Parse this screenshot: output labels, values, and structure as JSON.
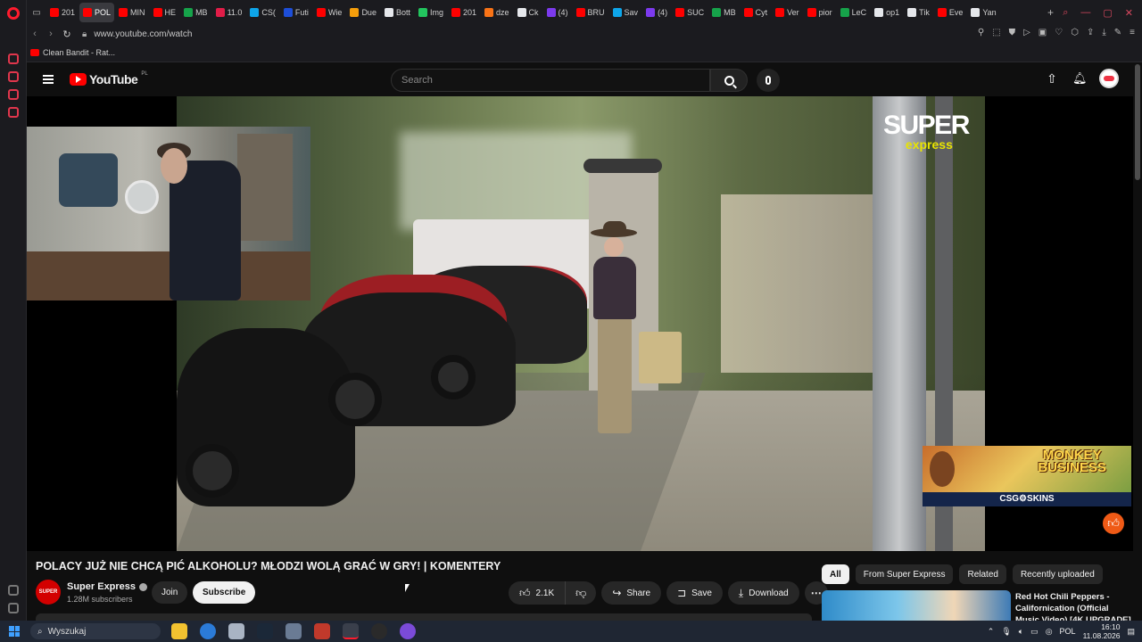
{
  "browser": {
    "tabs": [
      {
        "label": "201",
        "color": "#ff0000"
      },
      {
        "label": "POL",
        "color": "#ff0000",
        "active": true
      },
      {
        "label": "MIN",
        "color": "#ff0000"
      },
      {
        "label": "HE",
        "color": "#ff0000"
      },
      {
        "label": "MB",
        "color": "#16a34a"
      },
      {
        "label": "11.0",
        "color": "#e11d48"
      },
      {
        "label": "CS(",
        "color": "#0ea5e9"
      },
      {
        "label": "Futi",
        "color": "#1d4ed8"
      },
      {
        "label": "Wie",
        "color": "#ff0000"
      },
      {
        "label": "Due",
        "color": "#f59e0b"
      },
      {
        "label": "Bott",
        "color": "#e5e7eb"
      },
      {
        "label": "Img",
        "color": "#22c55e"
      },
      {
        "label": "201",
        "color": "#ff0000"
      },
      {
        "label": "dze",
        "color": "#f97316"
      },
      {
        "label": "Ck",
        "color": "#e5e7eb"
      },
      {
        "label": "(4)",
        "color": "#7c3aed"
      },
      {
        "label": "BRU",
        "color": "#ff0000"
      },
      {
        "label": "Sav",
        "color": "#0ea5e9"
      },
      {
        "label": "(4)",
        "color": "#7c3aed"
      },
      {
        "label": "SUC",
        "color": "#ff0000"
      },
      {
        "label": "MB",
        "color": "#16a34a"
      },
      {
        "label": "Cyt",
        "color": "#ff0000"
      },
      {
        "label": "Ver",
        "color": "#ff0000"
      },
      {
        "label": "pior",
        "color": "#ff0000"
      },
      {
        "label": "LeC",
        "color": "#16a34a"
      },
      {
        "label": "op1",
        "color": "#e5e7eb"
      },
      {
        "label": "Tik",
        "color": "#e5e7eb"
      },
      {
        "label": "Eve",
        "color": "#ff0000"
      },
      {
        "label": "Yan",
        "color": "#e5e7eb"
      }
    ],
    "new_tab": "+",
    "url": "www.youtube.com/watch",
    "bookmark": "Clean Bandit - Rat..."
  },
  "youtube": {
    "logo_text": "YouTube",
    "region": "PL",
    "search_placeholder": "Search",
    "avatar_initial": ""
  },
  "video": {
    "overlay_brand_top": "SUPER",
    "overlay_brand_bottom": "express",
    "ad_title_line1": "MONKEY",
    "ad_title_line2": "BUSINESS",
    "ad_brand": "CSG⚙SKINS",
    "title": "POLACY JUŻ NIE CHCĄ PIĆ ALKOHOLU? MŁODZI WOLĄ GRAĆ W GRY! | KOMENTERY"
  },
  "channel": {
    "name": "Super Express",
    "subscribers": "1.28M subscribers",
    "avatar_text": "SUPER",
    "join_label": "Join",
    "subscribe_label": "Subscribe"
  },
  "actions": {
    "like_count": "2.1K",
    "share_label": "Share",
    "save_label": "Save",
    "download_label": "Download"
  },
  "filters": [
    "All",
    "From Super Express",
    "Related",
    "Recently uploaded"
  ],
  "recommended": {
    "title": "Red Hot Chili Peppers - Californication (Official Music Video) [4K UPGRADE]"
  },
  "taskbar": {
    "search_label": "Wyszukaj",
    "language": "POL",
    "time": "16:10",
    "date": "11.08.2026"
  },
  "colors": {
    "yt_red": "#ff0000",
    "opera_red": "#ff1b2d",
    "bg": "#0f0f0f"
  }
}
